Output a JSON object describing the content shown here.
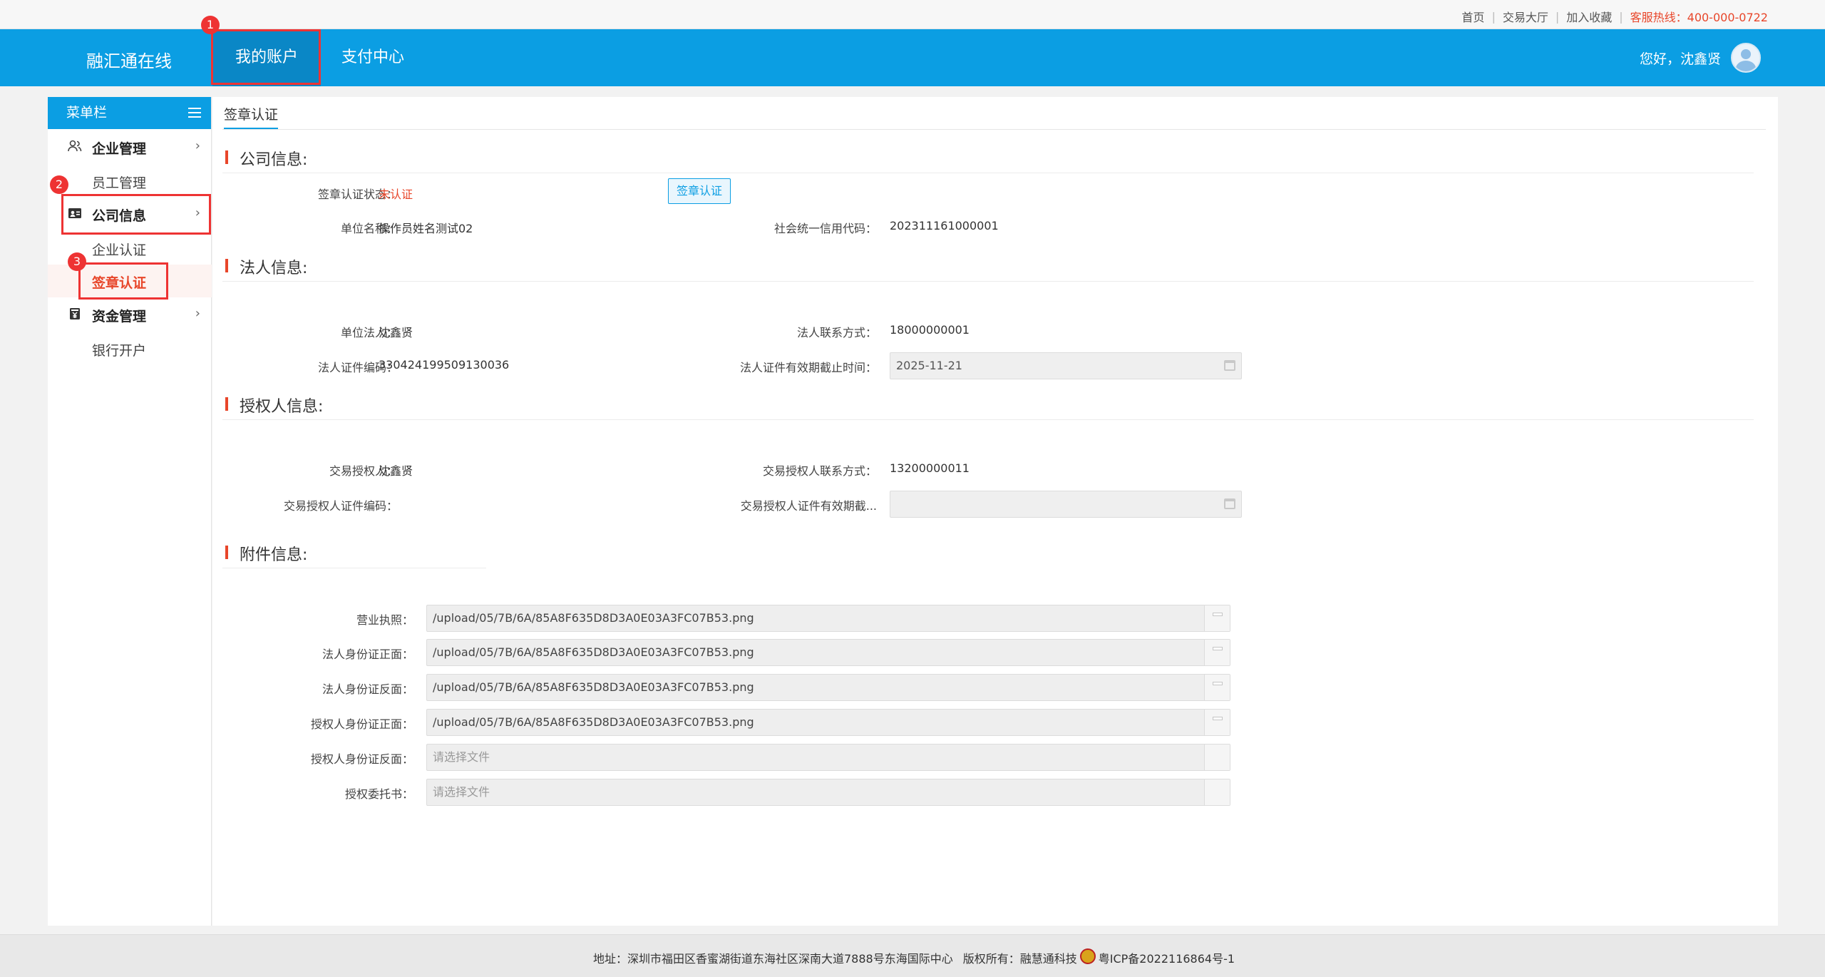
{
  "topbar": {
    "links": [
      "首页",
      "交易大厅",
      "加入收藏"
    ],
    "hotline": "客服热线：400-000-0722"
  },
  "header": {
    "brand": "融汇通在线",
    "nav": [
      {
        "label": "我的账户",
        "active": true
      },
      {
        "label": "支付中心",
        "active": false
      }
    ],
    "greeting": "您好，沈鑫贤",
    "avatar_icon": "user-avatar-icon"
  },
  "annotations": [
    "1",
    "2",
    "3"
  ],
  "sidebar": {
    "title": "菜单栏",
    "groups": [
      {
        "label": "企业管理",
        "icon": "users-icon",
        "items": [
          "员工管理"
        ]
      },
      {
        "label": "公司信息",
        "icon": "id-card-icon",
        "items": [
          "企业认证",
          "签章认证"
        ],
        "active_item": "签章认证"
      },
      {
        "label": "资金管理",
        "icon": "money-bag-icon",
        "items": [
          "银行开户"
        ]
      }
    ]
  },
  "content": {
    "tab": "签章认证",
    "company": {
      "title": "公司信息:",
      "status_label": "签章认证状态：",
      "status_value": "未认证",
      "auth_button": "签章认证",
      "name_label": "单位名称：",
      "name_value": "操作员姓名测试02",
      "credit_label": "社会统一信用代码：",
      "credit_value": "202311161000001"
    },
    "legal": {
      "title": "法人信息:",
      "person_label": "单位法人：",
      "person_value": "沈鑫贤",
      "phone_label": "法人联系方式：",
      "phone_value": "18000000001",
      "id_label": "法人证件编码：",
      "id_value": "330424199509130036",
      "expiry_label": "法人证件有效期截止时间：",
      "expiry_value": "2025-11-21"
    },
    "authorized": {
      "title": "授权人信息:",
      "person_label": "交易授权人：",
      "person_value": "沈鑫贤",
      "phone_label": "交易授权人联系方式：",
      "phone_value": "13200000011",
      "id_label": "交易授权人证件编码：",
      "id_value": "",
      "expiry_label": "交易授权人证件有效期截...",
      "expiry_value": ""
    },
    "attachments": {
      "title": "附件信息:",
      "placeholder": "请选择文件",
      "items": [
        {
          "label": "营业执照：",
          "value": "/upload/05/7B/6A/85A8F635D8D3A0E03A3FC07B53.png"
        },
        {
          "label": "法人身份证正面：",
          "value": "/upload/05/7B/6A/85A8F635D8D3A0E03A3FC07B53.png"
        },
        {
          "label": "法人身份证反面：",
          "value": "/upload/05/7B/6A/85A8F635D8D3A0E03A3FC07B53.png"
        },
        {
          "label": "授权人身份证正面：",
          "value": "/upload/05/7B/6A/85A8F635D8D3A0E03A3FC07B53.png"
        },
        {
          "label": "授权人身份证反面：",
          "value": ""
        },
        {
          "label": "授权委托书：",
          "value": ""
        }
      ]
    }
  },
  "footer": {
    "address": "地址：深圳市福田区香蜜湖街道东海社区深南大道7888号东海国际中心",
    "copyright": "版权所有：融慧通科技",
    "icp": "粤ICP备2022116864号-1"
  }
}
